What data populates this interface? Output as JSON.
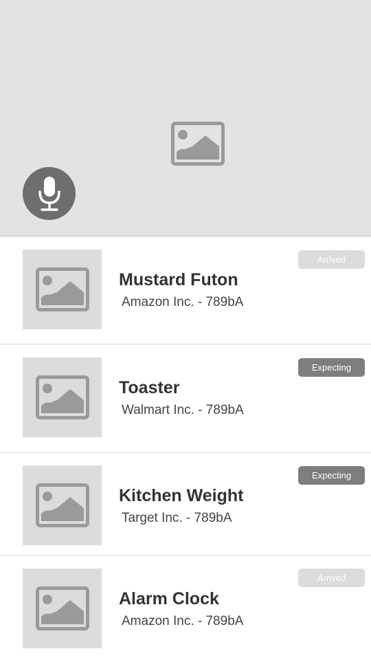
{
  "hero": {
    "image_icon": "image-placeholder-icon",
    "mic_icon": "microphone-icon"
  },
  "items": [
    {
      "title": "Mustard Futon",
      "subtitle": "Amazon Inc. - 789bA",
      "status": "Arrived"
    },
    {
      "title": "Toaster",
      "subtitle": "Walmart Inc. - 789bA",
      "status": "Expecting"
    },
    {
      "title": "Kitchen Weight",
      "subtitle": "Target Inc. - 789bA",
      "status": "Expecting"
    },
    {
      "title": "Alarm Clock",
      "subtitle": "Amazon Inc. - 789bA",
      "status": "Arrived"
    }
  ],
  "colors": {
    "hero_bg": "#e3e3e3",
    "mic_bg": "#6e6e6e",
    "badge_arrived": "#dcdcdc",
    "badge_expecting": "#7e7e7e"
  }
}
